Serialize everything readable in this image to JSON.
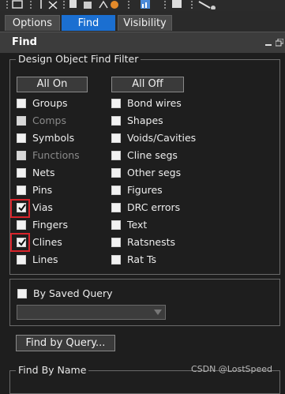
{
  "tabs": [
    {
      "label": "Options",
      "active": false
    },
    {
      "label": "Find",
      "active": true
    },
    {
      "label": "Visibility",
      "active": false
    }
  ],
  "panel": {
    "title": "Find"
  },
  "filter": {
    "group_label": "Design Object Find Filter",
    "all_on_label": "All On",
    "all_off_label": "All Off",
    "left_items": [
      {
        "label": "Groups",
        "checked": false,
        "disabled": false
      },
      {
        "label": "Comps",
        "checked": false,
        "disabled": true
      },
      {
        "label": "Symbols",
        "checked": false,
        "disabled": false
      },
      {
        "label": "Functions",
        "checked": false,
        "disabled": true
      },
      {
        "label": "Nets",
        "checked": false,
        "disabled": false
      },
      {
        "label": "Pins",
        "checked": false,
        "disabled": false
      },
      {
        "label": "Vias",
        "checked": true,
        "disabled": false
      },
      {
        "label": "Fingers",
        "checked": false,
        "disabled": false
      },
      {
        "label": "Clines",
        "checked": true,
        "disabled": false
      },
      {
        "label": "Lines",
        "checked": false,
        "disabled": false
      }
    ],
    "right_items": [
      {
        "label": "Bond wires",
        "checked": false
      },
      {
        "label": "Shapes",
        "checked": false
      },
      {
        "label": "Voids/Cavities",
        "checked": false
      },
      {
        "label": "Cline segs",
        "checked": false
      },
      {
        "label": "Other segs",
        "checked": false
      },
      {
        "label": "Figures",
        "checked": false
      },
      {
        "label": "DRC errors",
        "checked": false
      },
      {
        "label": "Text",
        "checked": false
      },
      {
        "label": "Ratsnests",
        "checked": false
      },
      {
        "label": "Rat Ts",
        "checked": false
      }
    ]
  },
  "saved_query": {
    "label": "By Saved Query",
    "checked": false,
    "dropdown_value": ""
  },
  "find_by_query_label": "Find by Query...",
  "find_by_name_label": "Find By Name",
  "watermark": "CSDN @LostSpeed",
  "colors": {
    "accent": "#1b6fd1",
    "highlight_box": "#d8232a",
    "background": "#1e1e1e"
  }
}
